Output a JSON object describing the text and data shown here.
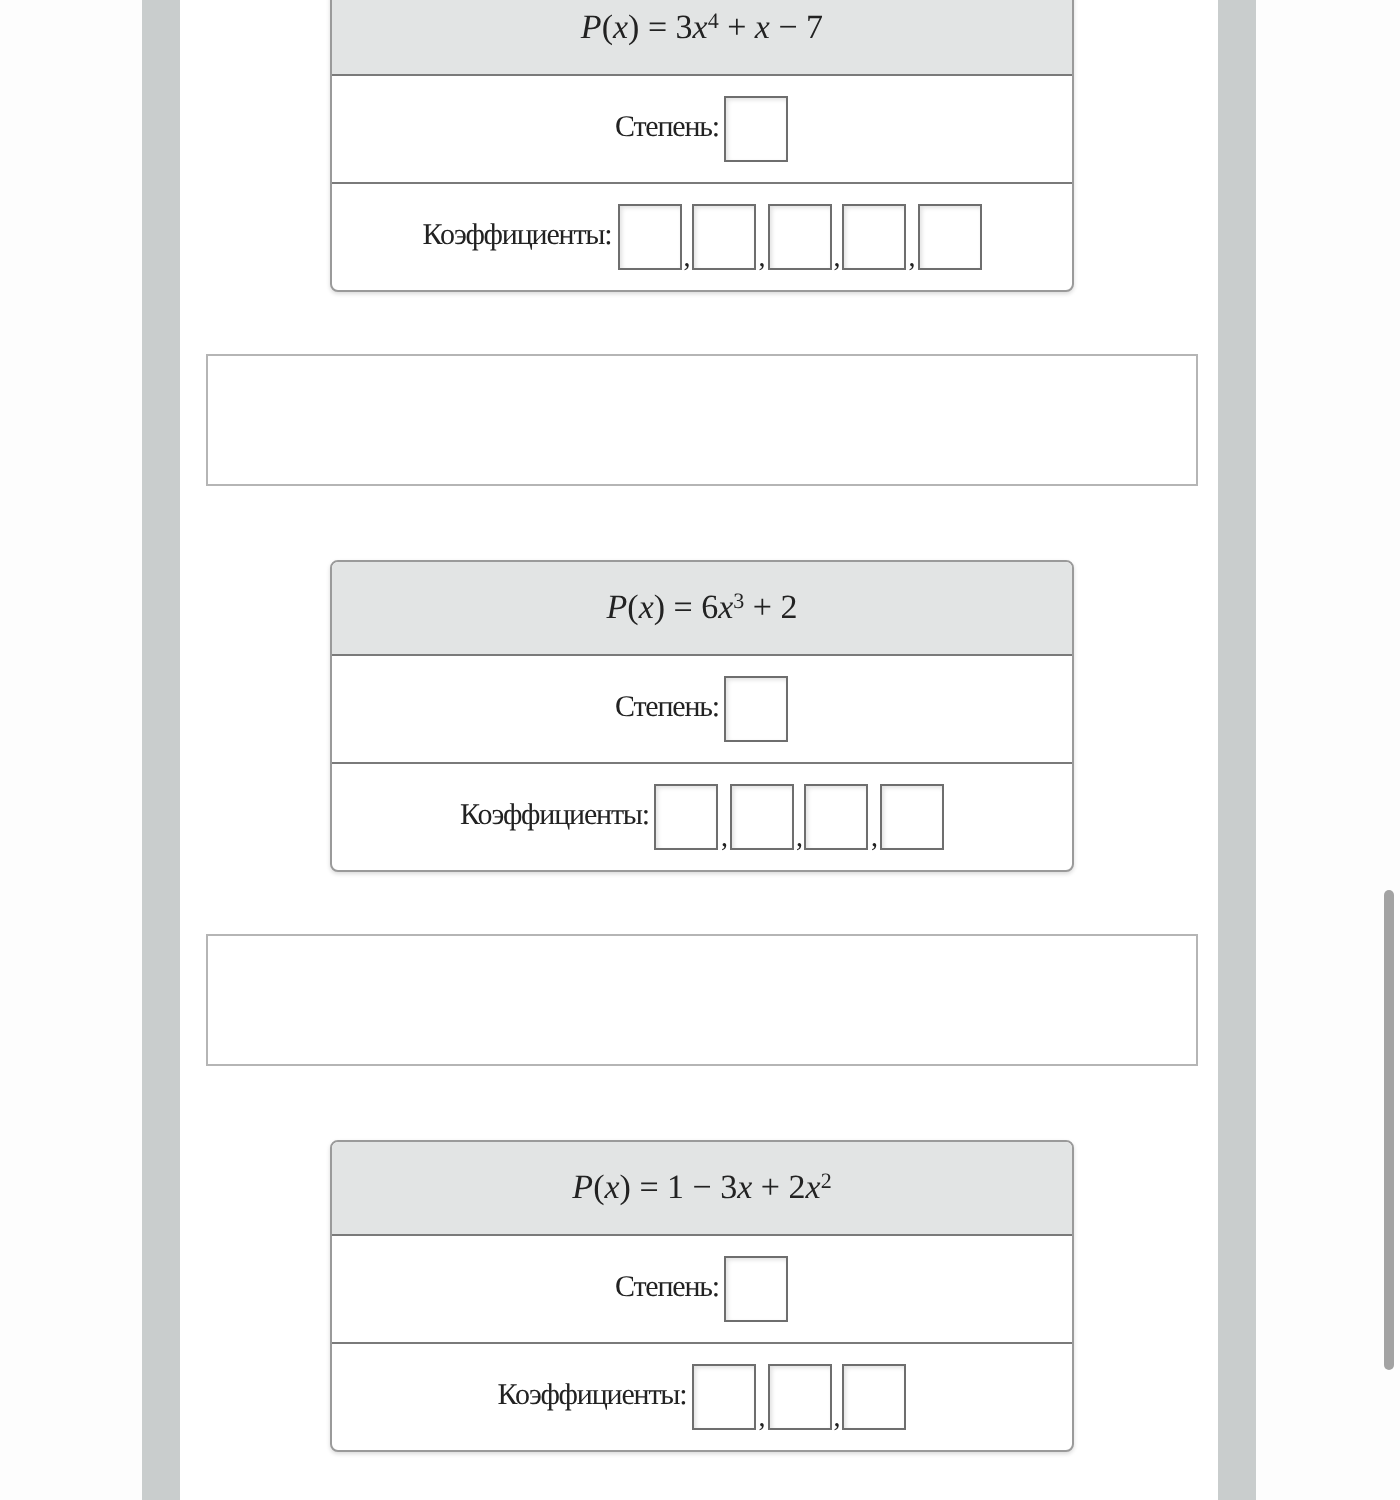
{
  "sections": [
    {
      "kind": "polynomial_table",
      "formula": [
        {
          "kind": "italic",
          "text": "P"
        },
        {
          "kind": "upright",
          "text": "("
        },
        {
          "kind": "italic",
          "text": "x"
        },
        {
          "kind": "upright",
          "text": ") = 3"
        },
        {
          "kind": "italic",
          "text": "x"
        },
        {
          "kind": "superscript",
          "text": "4"
        },
        {
          "kind": "upright",
          "text": " + "
        },
        {
          "kind": "italic",
          "text": "x"
        },
        {
          "kind": "upright",
          "text": " − 7"
        }
      ],
      "rows": [
        {
          "label": "Степень:",
          "items": [
            {
              "kind": "field"
            }
          ]
        },
        {
          "label": "Коэффициенты:",
          "items": [
            {
              "kind": "field"
            },
            {
              "kind": "separator",
              "text": ","
            },
            {
              "kind": "field"
            },
            {
              "kind": "separator",
              "text": ","
            },
            {
              "kind": "field"
            },
            {
              "kind": "separator",
              "text": ","
            },
            {
              "kind": "field"
            },
            {
              "kind": "separator",
              "text": ","
            },
            {
              "kind": "field"
            }
          ]
        }
      ]
    },
    {
      "kind": "answer_box"
    },
    {
      "kind": "polynomial_table",
      "formula": [
        {
          "kind": "italic",
          "text": "P"
        },
        {
          "kind": "upright",
          "text": "("
        },
        {
          "kind": "italic",
          "text": "x"
        },
        {
          "kind": "upright",
          "text": ") = 6"
        },
        {
          "kind": "italic",
          "text": "x"
        },
        {
          "kind": "superscript",
          "text": "3"
        },
        {
          "kind": "upright",
          "text": " + 2"
        }
      ],
      "rows": [
        {
          "label": "Степень:",
          "items": [
            {
              "kind": "field"
            }
          ]
        },
        {
          "label": "Коэффициенты:",
          "items": [
            {
              "kind": "field"
            },
            {
              "kind": "separator",
              "text": ","
            },
            {
              "kind": "field"
            },
            {
              "kind": "separator",
              "text": ","
            },
            {
              "kind": "field"
            },
            {
              "kind": "separator",
              "text": ","
            },
            {
              "kind": "field"
            }
          ]
        }
      ]
    },
    {
      "kind": "answer_box"
    },
    {
      "kind": "polynomial_table",
      "formula": [
        {
          "kind": "italic",
          "text": "P"
        },
        {
          "kind": "upright",
          "text": "("
        },
        {
          "kind": "italic",
          "text": "x"
        },
        {
          "kind": "upright",
          "text": ") = 1 − 3"
        },
        {
          "kind": "italic",
          "text": "x"
        },
        {
          "kind": "upright",
          "text": " + 2"
        },
        {
          "kind": "italic",
          "text": "x"
        },
        {
          "kind": "superscript",
          "text": "2"
        }
      ],
      "rows": [
        {
          "label": "Степень:",
          "items": [
            {
              "kind": "field"
            }
          ]
        },
        {
          "label": "Коэффициенты:",
          "items": [
            {
              "kind": "field"
            },
            {
              "kind": "separator",
              "text": ","
            },
            {
              "kind": "field"
            },
            {
              "kind": "separator",
              "text": ","
            },
            {
              "kind": "field"
            }
          ]
        }
      ]
    }
  ]
}
